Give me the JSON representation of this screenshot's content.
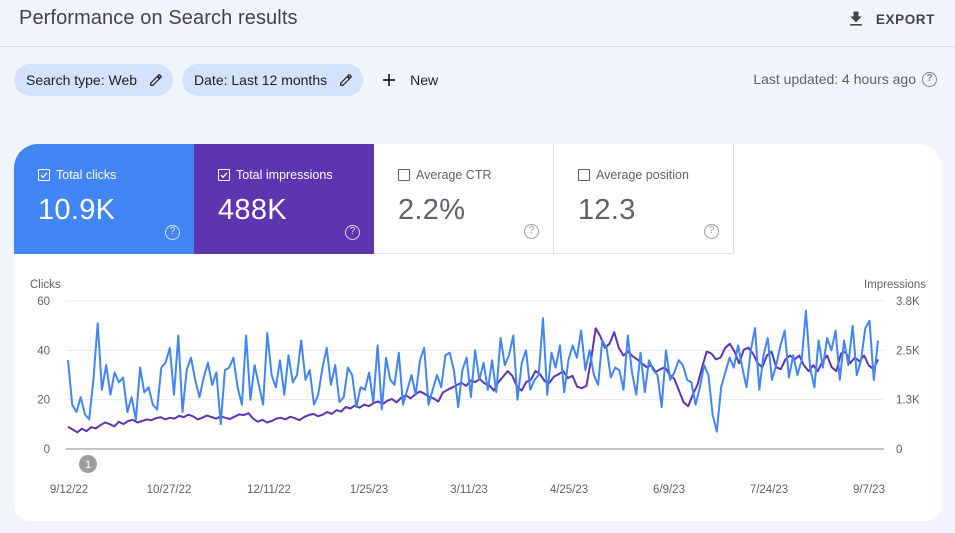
{
  "header": {
    "title": "Performance on Search results",
    "export_label": "EXPORT"
  },
  "filters": {
    "chips": [
      {
        "label": "Search type: Web"
      },
      {
        "label": "Date: Last 12 months"
      }
    ],
    "new_label": "New",
    "last_updated": "Last updated: 4 hours ago"
  },
  "metrics": [
    {
      "label": "Total clicks",
      "value": "10.9K",
      "checked": true,
      "color": "#4285f4"
    },
    {
      "label": "Total impressions",
      "value": "488K",
      "checked": true,
      "color": "#5e35b1"
    },
    {
      "label": "Average CTR",
      "value": "2.2%",
      "checked": false
    },
    {
      "label": "Average position",
      "value": "12.3",
      "checked": false
    }
  ],
  "annotation": {
    "label": "1"
  },
  "chart_data": {
    "type": "line",
    "title": "",
    "left_axis": {
      "label": "Clicks",
      "ticks": [
        "0",
        "20",
        "40",
        "60"
      ],
      "range": [
        0,
        60
      ]
    },
    "right_axis": {
      "label": "Impressions",
      "ticks": [
        "0",
        "1.3K",
        "2.5K",
        "3.8K"
      ],
      "range": [
        0,
        3800
      ]
    },
    "x_ticks": [
      "9/12/22",
      "10/27/22",
      "12/11/22",
      "1/25/23",
      "3/11/23",
      "4/25/23",
      "6/9/23",
      "7/24/23",
      "9/7/23"
    ],
    "grid": true,
    "x_start": "9/12/22",
    "x_end": "9/10/23",
    "sampling": "every 3 days",
    "series": [
      {
        "name": "Clicks",
        "axis": "left",
        "color": "#4285f4",
        "values": [
          36,
          18,
          15,
          21,
          14,
          12,
          28,
          51,
          24,
          34,
          22,
          31,
          27,
          29,
          15,
          21,
          12,
          33,
          23,
          25,
          18,
          16,
          33,
          35,
          41,
          22,
          46,
          15,
          32,
          37,
          28,
          21,
          29,
          35,
          26,
          31,
          10,
          32,
          33,
          37,
          25,
          18,
          46,
          20,
          34,
          26,
          18,
          47,
          30,
          25,
          36,
          22,
          38,
          27,
          30,
          44,
          28,
          32,
          18,
          22,
          33,
          41,
          26,
          34,
          19,
          21,
          33,
          30,
          17,
          25,
          24,
          31,
          19,
          42,
          16,
          37,
          28,
          26,
          39,
          18,
          24,
          30,
          22,
          36,
          41,
          18,
          24,
          30,
          25,
          38,
          39,
          32,
          17,
          32,
          37,
          21,
          40,
          28,
          35,
          24,
          36,
          23,
          45,
          34,
          38,
          46,
          20,
          35,
          40,
          24,
          28,
          30,
          53,
          22,
          39,
          33,
          42,
          23,
          36,
          42,
          37,
          48,
          32,
          40,
          30,
          26,
          44,
          41,
          29,
          33,
          32,
          24,
          46,
          31,
          22,
          39,
          23,
          36,
          32,
          30,
          17,
          40,
          28,
          31,
          36,
          34,
          28,
          27,
          18,
          25,
          34,
          30,
          14,
          7,
          25,
          31,
          37,
          33,
          42,
          33,
          25,
          40,
          49,
          24,
          38,
          45,
          28,
          34,
          42,
          48,
          29,
          38,
          30,
          36,
          56,
          33,
          25,
          44,
          33,
          45,
          40,
          48,
          28,
          44,
          34,
          50,
          30,
          36,
          49,
          52,
          28,
          44
        ],
        "note": "approximate, read from chart"
      },
      {
        "name": "Impressions",
        "axis": "right",
        "color": "#5e35b1",
        "values": [
          570,
          500,
          430,
          520,
          460,
          560,
          530,
          610,
          680,
          640,
          580,
          700,
          640,
          720,
          750,
          680,
          720,
          760,
          740,
          790,
          820,
          760,
          800,
          780,
          850,
          820,
          880,
          840,
          760,
          800,
          860,
          820,
          780,
          840,
          800,
          770,
          830,
          890,
          870,
          920,
          780,
          700,
          750,
          680,
          720,
          780,
          800,
          760,
          830,
          790,
          740,
          820,
          870,
          900,
          840,
          880,
          950,
          900,
          1000,
          960,
          1080,
          1040,
          1120,
          1060,
          1140,
          1100,
          1180,
          1220,
          1150,
          1240,
          1280,
          1200,
          1320,
          1380,
          1300,
          1400,
          1480,
          1420,
          1340,
          1300,
          1220,
          1450,
          1520,
          1580,
          1640,
          1700,
          1620,
          1760,
          1720,
          1800,
          1680,
          1640,
          1500,
          1720,
          1860,
          2000,
          1880,
          1600,
          1500,
          1720,
          1780,
          2000,
          1920,
          1740,
          1700,
          1860,
          1920,
          2000,
          1820,
          1880,
          1600,
          1560,
          1620,
          2280,
          3100,
          2900,
          2600,
          2700,
          3000,
          2600,
          2400,
          2500,
          2380,
          2300,
          2200,
          2100,
          2150,
          1980,
          2050,
          2100,
          1900,
          1800,
          1500,
          1200,
          1100,
          1400,
          1650,
          2100,
          2500,
          2450,
          2300,
          2350,
          2600,
          2700,
          2500,
          2200,
          2550,
          2600,
          2450,
          2200,
          2100,
          2400,
          2500,
          2100,
          2050,
          2300,
          2400,
          2300,
          2400,
          2150,
          2000,
          2150,
          2000,
          2250,
          2400,
          2100,
          2000,
          2450,
          2500,
          2200,
          2350,
          2250,
          2400,
          2150,
          2050,
          2300
        ],
        "note": "approximate, read from chart"
      }
    ]
  }
}
